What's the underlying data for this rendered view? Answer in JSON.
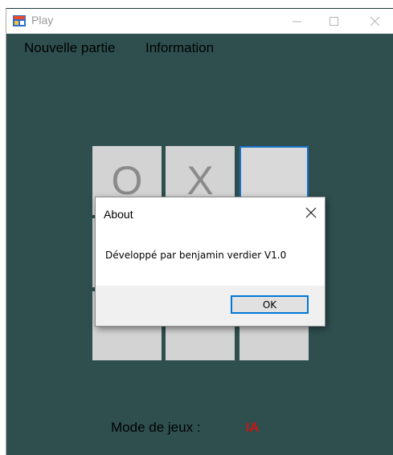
{
  "window": {
    "title": "Play",
    "app_icon": "game-window-icon",
    "controls": [
      "minimize-icon",
      "maximize-icon",
      "close-icon"
    ]
  },
  "menu": {
    "items": [
      {
        "label": "Nouvelle partie"
      },
      {
        "label": "Information"
      }
    ]
  },
  "board": {
    "cells": [
      "O",
      "X",
      "",
      "",
      "",
      "",
      "",
      "",
      ""
    ],
    "focused_cell": 2
  },
  "status": {
    "mode_label": "Mode de jeux :",
    "mode_value": "IA",
    "mode_value_color": "#ff0000"
  },
  "dialog": {
    "title": "About",
    "message": "Développé par benjamin verdier V1.0",
    "ok_label": "OK"
  },
  "colors": {
    "background": "#2f4f4f",
    "cell": "#d3d3d3",
    "focus": "#1a73c9",
    "accent": "#0078d7"
  }
}
